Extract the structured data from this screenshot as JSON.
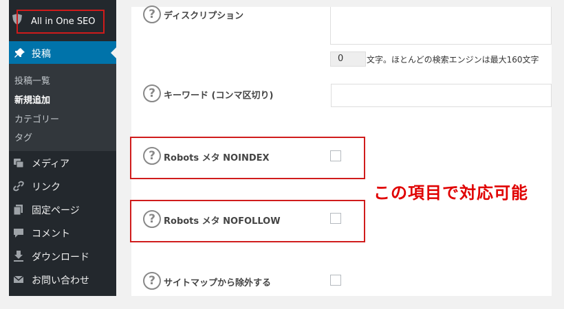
{
  "sidebar": {
    "plugin_label": "All in One SEO",
    "current": "投稿",
    "submenu": [
      "投稿一覧",
      "新規追加",
      "カテゴリー",
      "タグ"
    ],
    "active_sub_index": 1,
    "menu": [
      {
        "label": "メディア",
        "icon": "media-icon"
      },
      {
        "label": "リンク",
        "icon": "link-icon"
      },
      {
        "label": "固定ページ",
        "icon": "page-icon"
      },
      {
        "label": "コメント",
        "icon": "comment-icon"
      },
      {
        "label": "ダウンロード",
        "icon": "download-icon"
      },
      {
        "label": "お問い合わせ",
        "icon": "mail-icon"
      }
    ]
  },
  "seo": {
    "description_label": "ディスクリプション",
    "counter_value": "0",
    "counter_text": "文字。ほとんどの検索エンジンは最大160文字",
    "keywords_label": "キーワード (コンマ区切り)",
    "noindex_label": "Robots メタ NOINDEX",
    "nofollow_label": "Robots メタ NOFOLLOW",
    "sitemap_label": "サイトマップから除外する",
    "help_glyph": "?"
  },
  "annotation": "この項目で対応可能",
  "colors": {
    "sidebar": "#23282d",
    "submenu": "#32373c",
    "accent": "#0073aa",
    "highlight": "#d01b1b",
    "annotation": "#e00000"
  }
}
